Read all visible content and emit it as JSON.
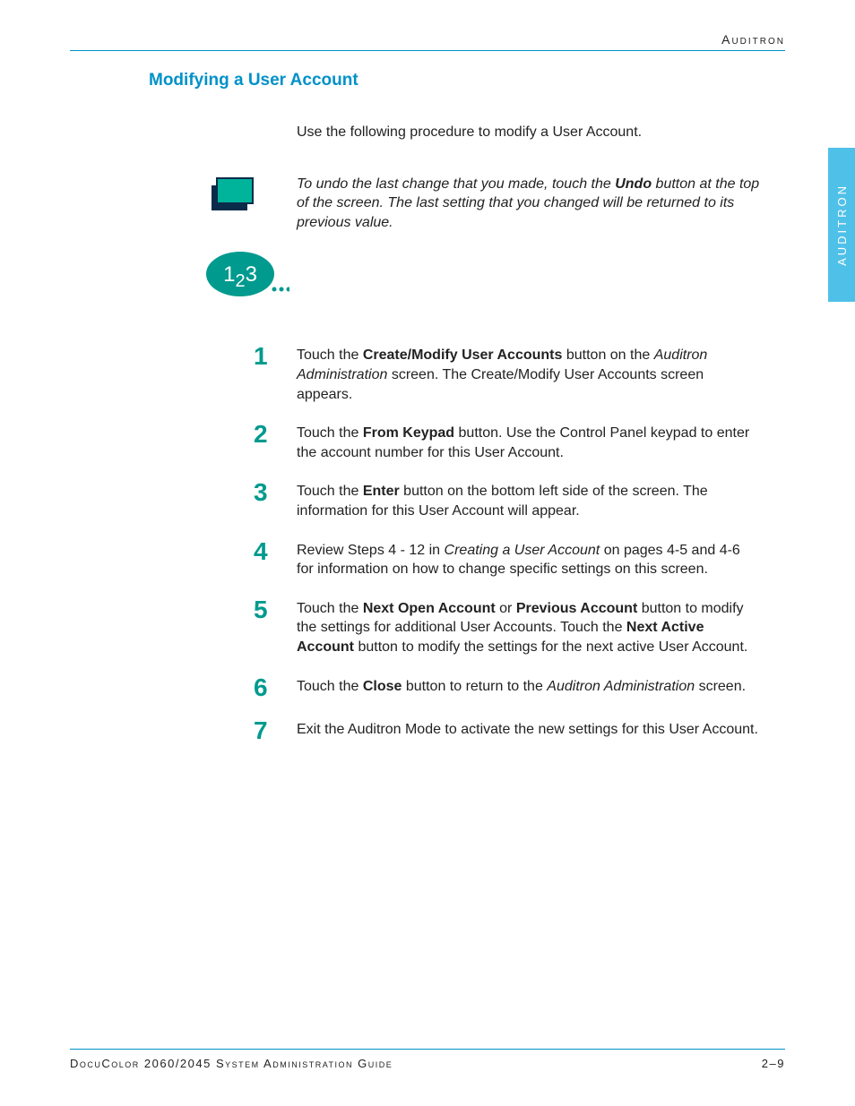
{
  "header": {
    "label": "Auditron"
  },
  "sideTab": {
    "label": "AUDITRON"
  },
  "section": {
    "title": "Modifying a User Account"
  },
  "intro": "Use the following procedure to modify a User Account.",
  "note": {
    "pre": "To undo the last change that you made, touch the ",
    "bold": "Undo",
    "post": " button at the top of the screen. The last setting that you changed will be returned to its previous value."
  },
  "steps": [
    {
      "n": "1",
      "parts": [
        {
          "t": "Touch the "
        },
        {
          "b": "Create/Modify User Accounts"
        },
        {
          "t": " button on the "
        },
        {
          "i": "Auditron Administration"
        },
        {
          "t": " screen. The Create/Modify User Accounts screen appears."
        }
      ]
    },
    {
      "n": "2",
      "parts": [
        {
          "t": "Touch the "
        },
        {
          "b": "From Keypad"
        },
        {
          "t": " button. Use the Control Panel keypad to enter the account number for this User Account."
        }
      ]
    },
    {
      "n": "3",
      "parts": [
        {
          "t": "Touch the "
        },
        {
          "b": "Enter"
        },
        {
          "t": " button on the bottom left side of the screen. The information for this User Account will appear."
        }
      ]
    },
    {
      "n": "4",
      "parts": [
        {
          "t": "Review Steps 4 - 12 in "
        },
        {
          "i": "Creating a User Account"
        },
        {
          "t": " on pages 4-5 and 4-6 for information on how to change specific settings on this screen."
        }
      ]
    },
    {
      "n": "5",
      "parts": [
        {
          "t": "Touch the "
        },
        {
          "b": "Next Open Account"
        },
        {
          "t": " or "
        },
        {
          "b": "Previous Account"
        },
        {
          "t": " button to modify the settings for additional User Accounts. Touch the "
        },
        {
          "b": "Next Active Account"
        },
        {
          "t": " button to modify the settings for the next active User Account."
        }
      ]
    },
    {
      "n": "6",
      "parts": [
        {
          "t": "Touch the "
        },
        {
          "b": "Close"
        },
        {
          "t": " button to return to the "
        },
        {
          "i": "Auditron Administration"
        },
        {
          "t": " screen."
        }
      ]
    },
    {
      "n": "7",
      "parts": [
        {
          "t": "Exit the Auditron Mode to activate the new settings for this User Account."
        }
      ]
    }
  ],
  "footer": {
    "left": "DocuColor 2060/2045 System Administration Guide",
    "right": "2–9"
  }
}
